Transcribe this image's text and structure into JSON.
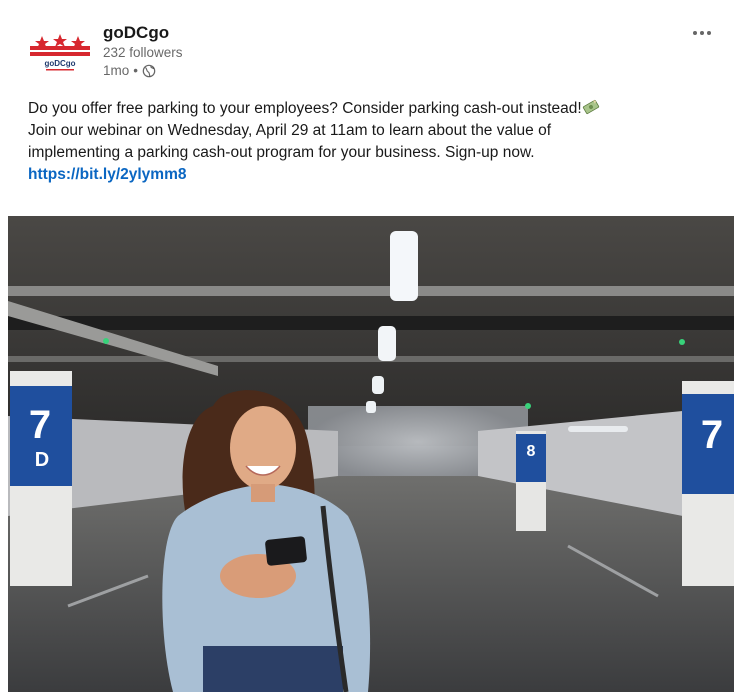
{
  "post": {
    "author": {
      "name": "goDCgo",
      "followers": "232 followers",
      "time": "1mo",
      "separator": "•",
      "logo_text": "goDCgo"
    },
    "menu_icon": "more-horizontal-icon",
    "commentary": {
      "line1": "Do you offer free parking to your employees? Consider parking cash-out instead!",
      "line2": "Join our webinar on Wednesday, April 29 at 11am to learn about the value of",
      "line3": "implementing a parking cash-out program for your business. Sign-up now.",
      "link": "https://bit.ly/2ylymm8"
    },
    "image": {
      "pillar_labels": {
        "left": "7",
        "left_sub": "D",
        "center": "8",
        "right": "7"
      }
    }
  },
  "colors": {
    "link": "#0a66c2",
    "brand_red": "#d7282f",
    "pillar_blue": "#1f4f9e"
  }
}
